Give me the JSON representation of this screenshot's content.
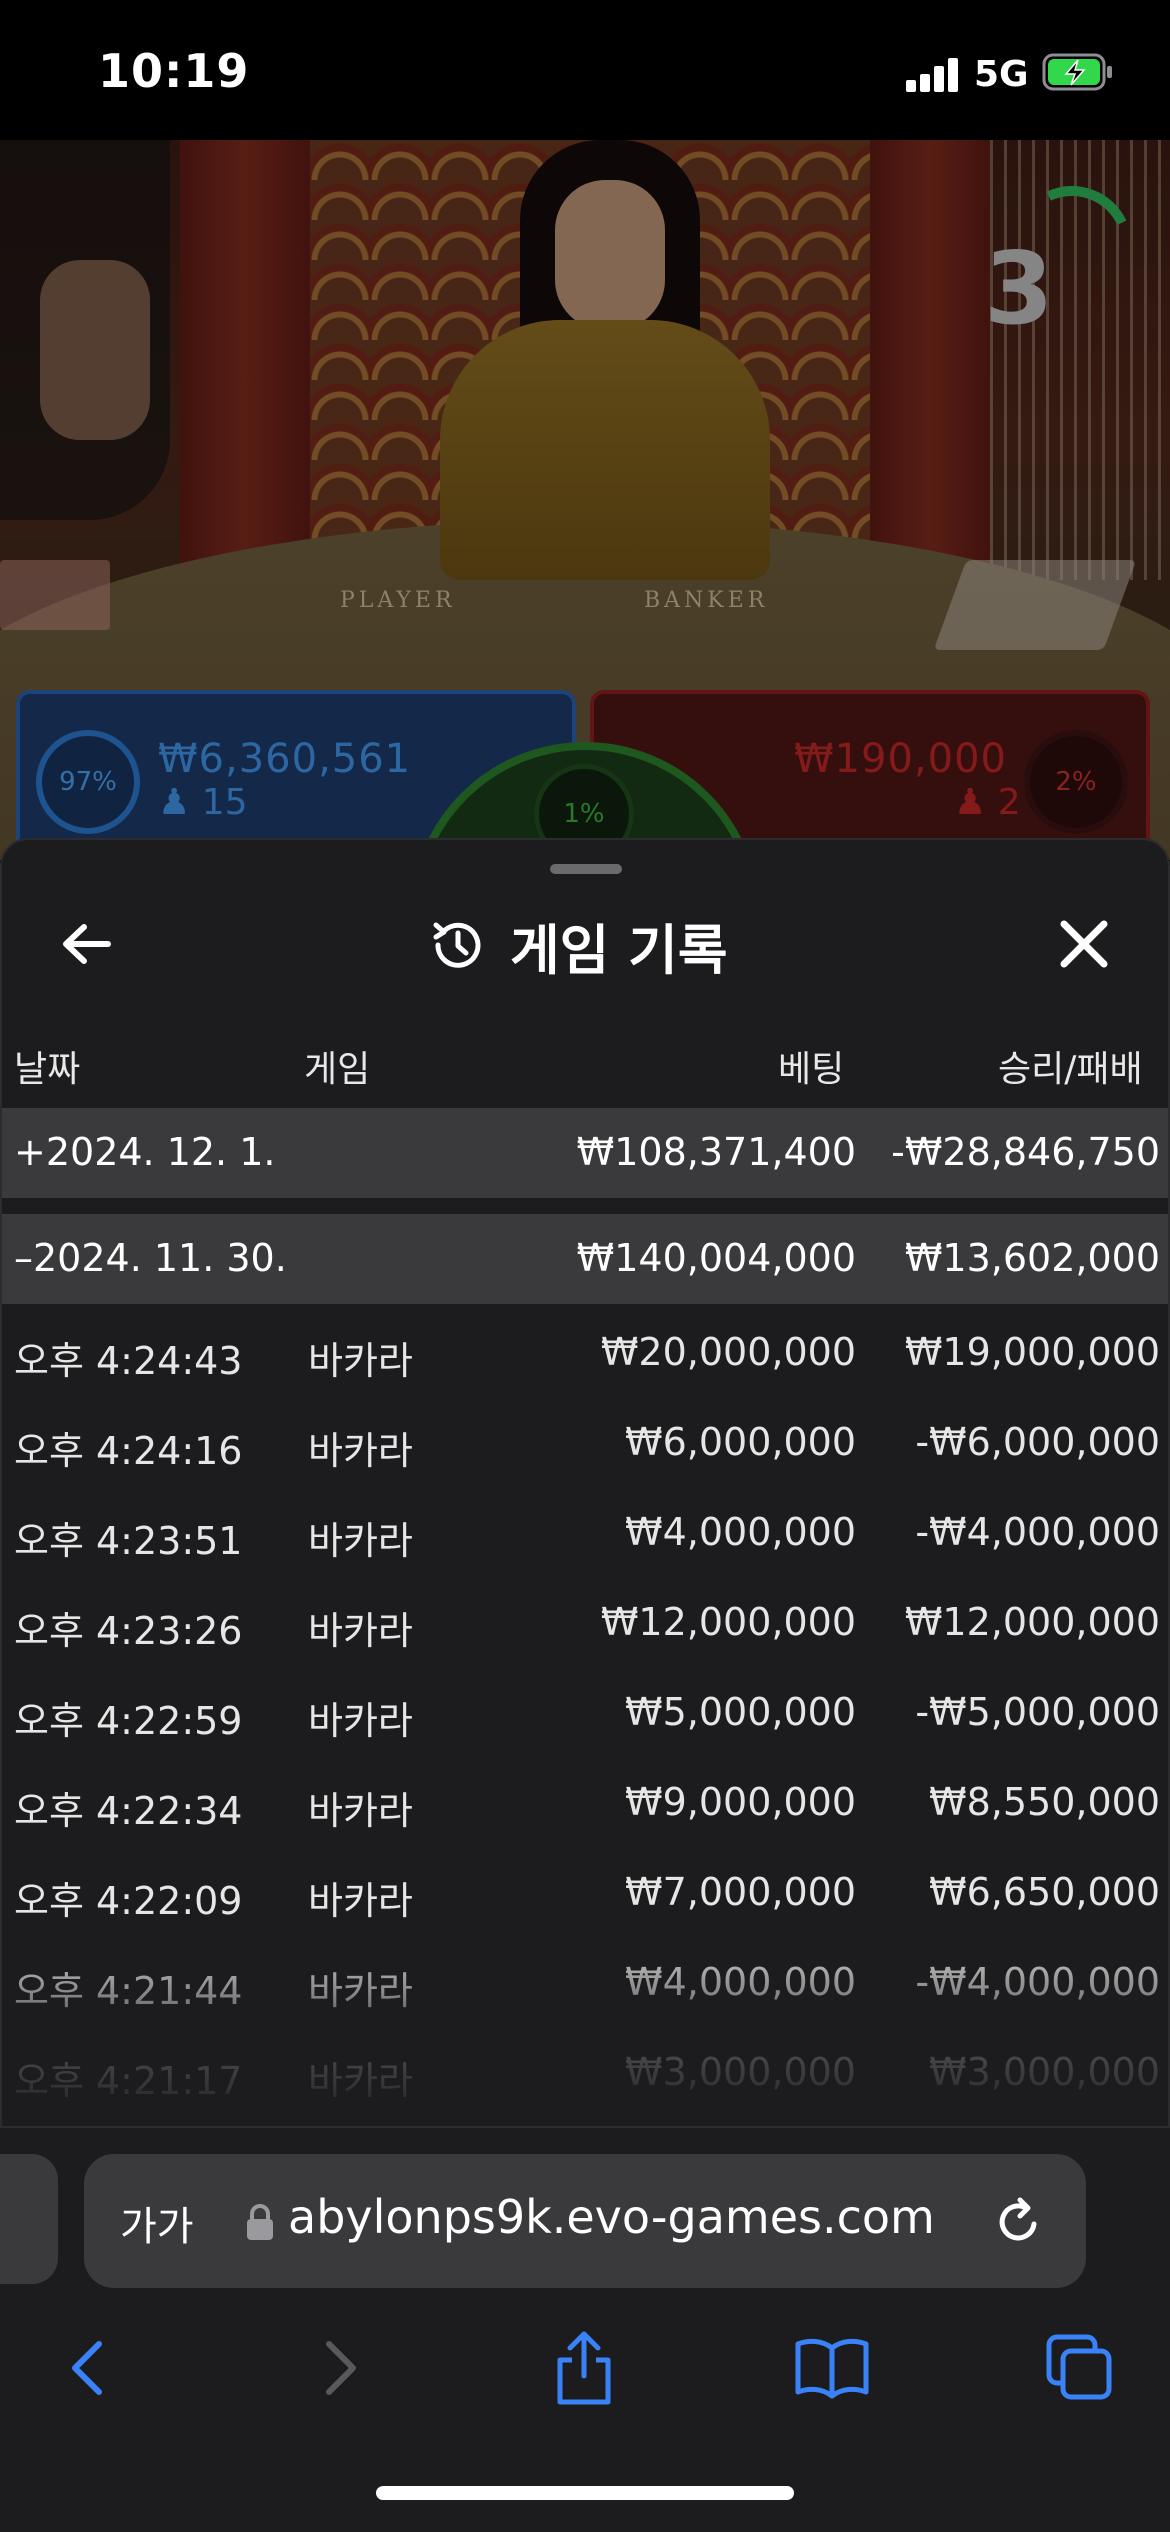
{
  "status_bar": {
    "time": "10:19",
    "network": "5G"
  },
  "video": {
    "table_labels": {
      "player": "PLAYER",
      "banker": "BANKER"
    },
    "countdown": "3",
    "player_bet": {
      "percent": "97%",
      "amount": "₩6,360,561",
      "count": "15"
    },
    "banker_bet": {
      "percent": "2%",
      "amount": "₩190,000",
      "count": "2"
    },
    "tie_bet": {
      "percent": "1%"
    }
  },
  "history": {
    "title": "게임 기록",
    "columns": {
      "date": "날짜",
      "game": "게임",
      "bet": "베팅",
      "result": "승리/패배"
    },
    "groups": [
      {
        "date": "+2024. 12. 1.",
        "bet": "₩108,371,400",
        "result": "-₩28,846,750"
      },
      {
        "date": "–2024. 11. 30.",
        "bet": "₩140,004,000",
        "result": "₩13,602,000"
      }
    ],
    "rows": [
      {
        "time": "오후 4:24:43",
        "game": "바카라",
        "bet": "₩20,000,000",
        "result": "₩19,000,000"
      },
      {
        "time": "오후 4:24:16",
        "game": "바카라",
        "bet": "₩6,000,000",
        "result": "-₩6,000,000"
      },
      {
        "time": "오후 4:23:51",
        "game": "바카라",
        "bet": "₩4,000,000",
        "result": "-₩4,000,000"
      },
      {
        "time": "오후 4:23:26",
        "game": "바카라",
        "bet": "₩12,000,000",
        "result": "₩12,000,000"
      },
      {
        "time": "오후 4:22:59",
        "game": "바카라",
        "bet": "₩5,000,000",
        "result": "-₩5,000,000"
      },
      {
        "time": "오후 4:22:34",
        "game": "바카라",
        "bet": "₩9,000,000",
        "result": "₩8,550,000"
      },
      {
        "time": "오후 4:22:09",
        "game": "바카라",
        "bet": "₩7,000,000",
        "result": "₩6,650,000"
      },
      {
        "time": "오후 4:21:44",
        "game": "바카라",
        "bet": "₩4,000,000",
        "result": "-₩4,000,000"
      },
      {
        "time": "오후 4:21:17",
        "game": "바카라",
        "bet": "₩3,000,000",
        "result": "₩3,000,000"
      }
    ]
  },
  "browser": {
    "text_size_button": "가가",
    "url": "abylonps9k.evo-games.com"
  },
  "colors": {
    "sheet_bg": "#1c1c1e",
    "group_row_bg": "#3a3a3c",
    "accent_blue": "#3a82f7",
    "player_blue": "#3f8fe0",
    "banker_red": "#b82424",
    "battery_green": "#32d74b"
  }
}
